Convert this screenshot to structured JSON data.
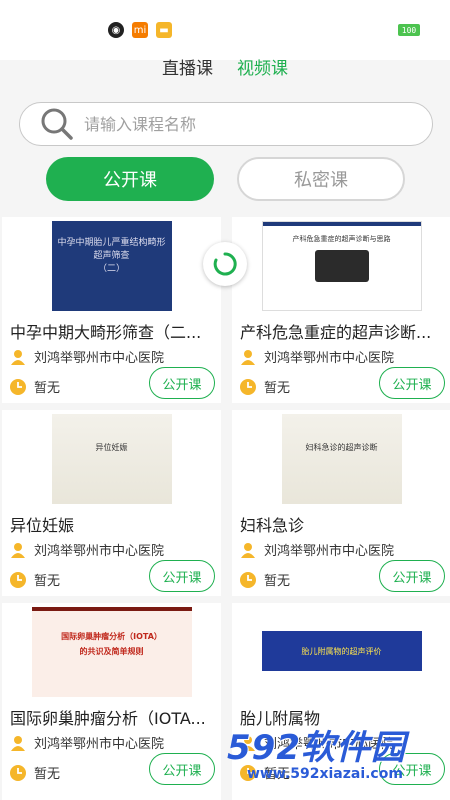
{
  "status_bar": {
    "battery": "100"
  },
  "top_tabs": [
    {
      "label": "直播课",
      "active": false
    },
    {
      "label": "视频课",
      "active": true
    }
  ],
  "search": {
    "placeholder": "请输入课程名称"
  },
  "segments": {
    "public": "公开课",
    "private": "私密课"
  },
  "courses": [
    {
      "title": "中孕中期大畸形筛查（二...",
      "teacher": "刘鸿举鄂州市中心医院",
      "time": "暂无",
      "badge": "公开课",
      "thumb_text": [
        "中孕中期胎儿严重结构畸形",
        "超声筛查",
        "（二）"
      ]
    },
    {
      "title": "产科危急重症的超声诊断...",
      "teacher": "刘鸿举鄂州市中心医院",
      "time": "暂无",
      "badge": "公开课",
      "thumb_text": [
        "产科危急重症的超声诊断与思路"
      ]
    },
    {
      "title": "异位妊娠",
      "teacher": "刘鸿举鄂州市中心医院",
      "time": "暂无",
      "badge": "公开课",
      "thumb_text": [
        "异位妊娠"
      ]
    },
    {
      "title": "妇科急诊",
      "teacher": "刘鸿举鄂州市中心医院",
      "time": "暂无",
      "badge": "公开课",
      "thumb_text": [
        "妇科急诊的超声诊断"
      ]
    },
    {
      "title": "国际卵巢肿瘤分析（IOTA...",
      "teacher": "刘鸿举鄂州市中心医院",
      "time": "暂无",
      "badge": "公开课",
      "thumb_text": [
        "国际卵巢肿瘤分析（IOTA）",
        "的共识及简单规则"
      ]
    },
    {
      "title": "胎儿附属物",
      "teacher": "刘鸿举鄂州市中心医院",
      "time": "暂无",
      "badge": "公开课",
      "thumb_text": [
        "胎儿附属物的超声评价"
      ]
    }
  ],
  "watermark": {
    "brand": "592软件园",
    "url": "www.592xiazai.com"
  },
  "colors": {
    "accent": "#1fb050",
    "icon_yellow": "#f5b62a"
  }
}
